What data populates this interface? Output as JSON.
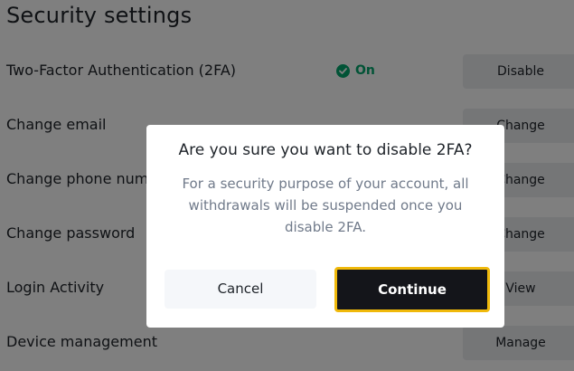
{
  "page": {
    "title": "Security settings"
  },
  "settings": [
    {
      "label": "Two-Factor Authentication (2FA)",
      "status": "On",
      "action": "Disable"
    },
    {
      "label": "Change email",
      "action": "Change"
    },
    {
      "label": "Change phone number",
      "action": "Change"
    },
    {
      "label": "Change password",
      "action": "Change"
    },
    {
      "label": "Login Activity",
      "action": "View"
    },
    {
      "label": "Device management",
      "action": "Manage"
    }
  ],
  "dialog": {
    "title": "Are you sure you want to disable 2FA?",
    "message": "For a security purpose of your account, all withdrawals will be suspended once you disable 2FA.",
    "cancel_label": "Cancel",
    "continue_label": "Continue"
  },
  "colors": {
    "status_on": "#03a66d",
    "focus_outline": "#f0b90b",
    "primary_button": "#14151a"
  }
}
